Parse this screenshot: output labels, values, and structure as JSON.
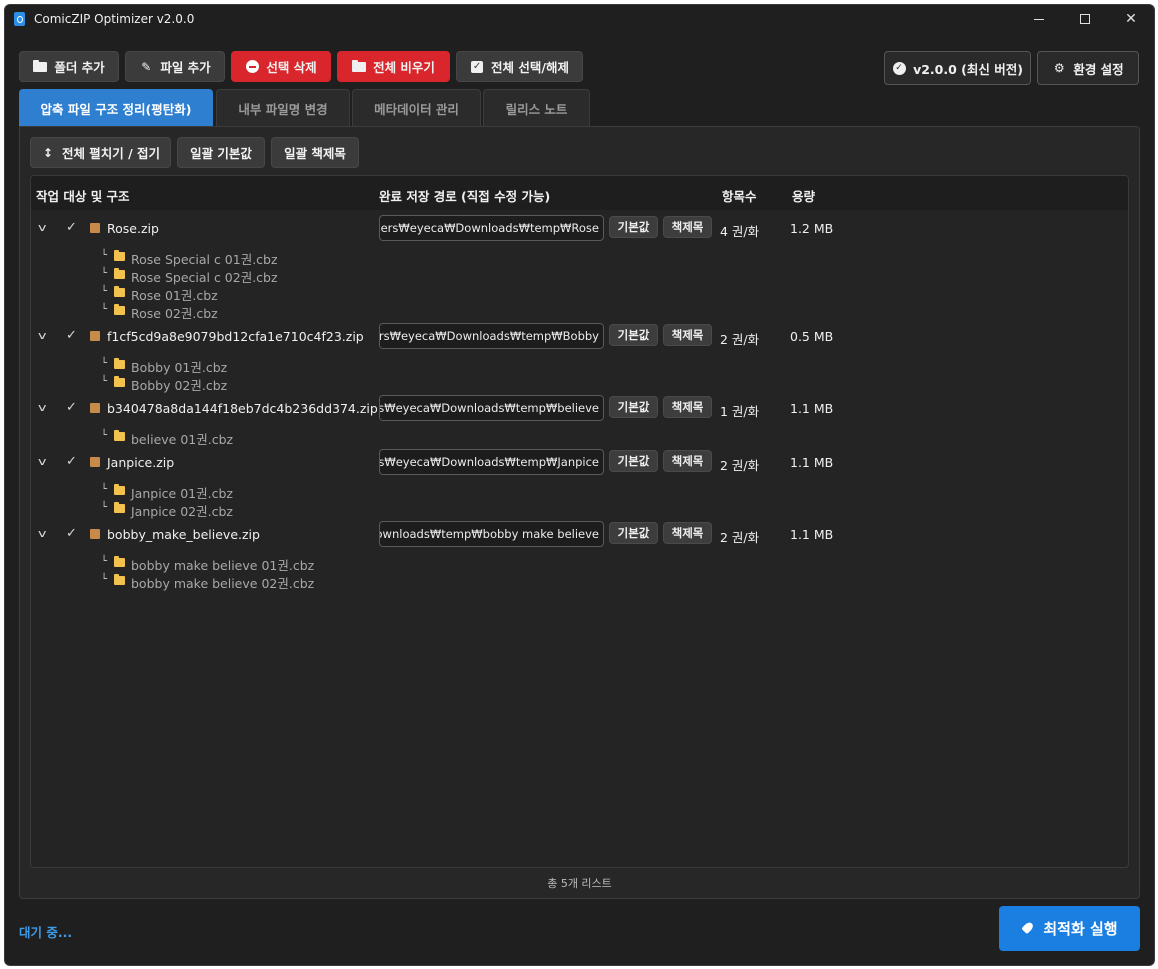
{
  "window": {
    "title": "ComicZIP Optimizer v2.0.0"
  },
  "toolbar": {
    "add_folder": "폴더 추가",
    "add_file": "파일 추가",
    "delete_selected": "선택 삭제",
    "clear_all": "전체 비우기",
    "toggle_select_all": "전체 선택/해제",
    "version": "v2.0.0 (최신 버전)",
    "settings": "환경 설정"
  },
  "tabs": [
    {
      "label": "압축 파일 구조 정리(평탄화)",
      "active": true
    },
    {
      "label": "내부 파일명 변경",
      "active": false
    },
    {
      "label": "메타데이터 관리",
      "active": false
    },
    {
      "label": "릴리스 노트",
      "active": false
    }
  ],
  "actions": {
    "expand_collapse": "전체 펼치기 / 접기",
    "batch_default": "일괄 기본값",
    "batch_title": "일괄 책제목"
  },
  "columns": {
    "target": "작업 대상 및 구조",
    "save_path": "완료 저장 경로 (직접 수정 가능)",
    "count": "항목수",
    "size": "용량"
  },
  "row_buttons": {
    "default": "기본값",
    "title": "책제목"
  },
  "items": [
    {
      "name": "Rose.zip",
      "path": "C:₩Users₩eyeca₩Downloads₩temp₩Rose",
      "count": "4 권/화",
      "size": "1.2 MB",
      "children": [
        "Rose Special c 01권.cbz",
        "Rose Special c 02권.cbz",
        "Rose 01권.cbz",
        "Rose 02권.cbz"
      ]
    },
    {
      "name": "f1cf5cd9a8e9079bd12cfa1e710c4f23.zip",
      "path": "₩Users₩eyeca₩Downloads₩temp₩Bobby",
      "count": "2 권/화",
      "size": "0.5 MB",
      "children": [
        "Bobby 01권.cbz",
        "Bobby 02권.cbz"
      ]
    },
    {
      "name": "b340478a8da144f18eb7dc4b236dd374.zip",
      "path": "₩Users₩eyeca₩Downloads₩temp₩believe",
      "count": "1 권/화",
      "size": "1.1 MB",
      "children": [
        "believe 01권.cbz"
      ]
    },
    {
      "name": "Janpice.zip",
      "path": "₩Users₩eyeca₩Downloads₩temp₩Janpice",
      "count": "2 권/화",
      "size": "1.1 MB",
      "children": [
        "Janpice 01권.cbz",
        "Janpice 02권.cbz"
      ]
    },
    {
      "name": "bobby_make_believe.zip",
      "path": "₩Downloads₩temp₩bobby make believe",
      "count": "2 권/화",
      "size": "1.1 MB",
      "children": [
        "bobby make believe 01권.cbz",
        "bobby make believe 02권.cbz"
      ]
    }
  ],
  "total": "총 5개 리스트",
  "status": "대기 중...",
  "run": "최적화 실행",
  "colors": {
    "accent": "#2f7fd0",
    "danger": "#d9262c",
    "run": "#1a7fe0",
    "folder": "#f2c14e",
    "archive": "#c88a4a"
  }
}
